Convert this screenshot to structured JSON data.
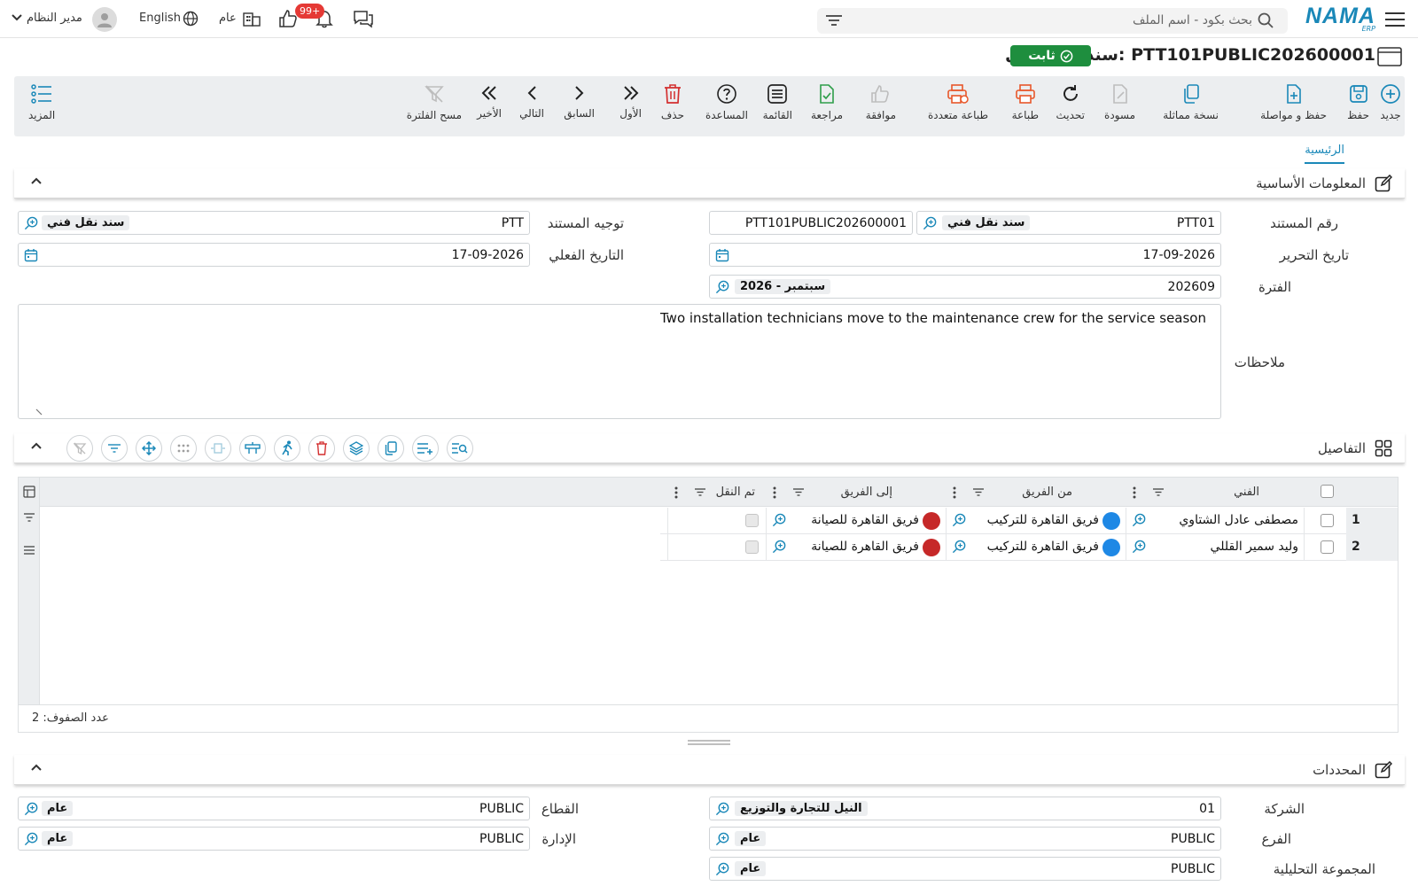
{
  "topbar": {
    "logo": "NAMA",
    "logo_sub": "ERP",
    "search_placeholder": "بحث بكود - اسم الملف",
    "user": "مدير النظام",
    "language": "English",
    "company_short": "عام",
    "notifications_badge": "99+"
  },
  "header": {
    "title": "سند نقل فني: PTT101PUBLIC202600001",
    "status": "ثابت"
  },
  "toolbar": {
    "new": "جديد",
    "save": "حفظ",
    "save_continue": "حفظ و مواصلة",
    "duplicate": "نسخة مماثلة",
    "draft": "مسودة",
    "refresh": "تحديث",
    "print": "طباعة",
    "multi_print": "طباعة متعددة",
    "approve": "موافقة",
    "review": "مراجعة",
    "list": "القائمة",
    "help": "المساعدة",
    "delete": "حذف",
    "first": "الأول",
    "previous": "السابق",
    "next": "التالي",
    "last": "الأخير",
    "clear_filter": "مسح الفلترة",
    "more": "المزيد"
  },
  "tabs": {
    "main": "الرئيسية"
  },
  "basic_info": {
    "section_title": "المعلومات الأساسية",
    "doc_number_label": "رقم المستند",
    "doc_code": "PTT01",
    "doc_type": "سند نقل فني",
    "doc_number": "PTT101PUBLIC202600001",
    "direction_label": "توجيه المستند",
    "direction_code": "PTT",
    "direction_name": "سند نقل فني",
    "edit_date_label": "تاريخ التحرير",
    "edit_date": "17-09-2026",
    "actual_date_label": "التاريخ الفعلي",
    "actual_date": "17-09-2026",
    "period_label": "الفترة",
    "period_code": "202609",
    "period_name": "2026 - سبتمبر",
    "notes_label": "ملاحظات",
    "notes": "Two installation technicians move to the maintenance crew for the service season"
  },
  "details": {
    "section_title": "التفاصيل",
    "columns": {
      "technician": "الفني",
      "from_team": "من الفريق",
      "to_team": "إلى الفريق",
      "transferred": "تم النقل"
    },
    "rows": [
      {
        "num": "1",
        "technician": "مصطفى عادل الشتاوي",
        "from_team": "فريق القاهرة للتركيب",
        "to_team": "فريق القاهرة للصيانة"
      },
      {
        "num": "2",
        "technician": "وليد سمير القللي",
        "from_team": "فريق القاهرة للتركيب",
        "to_team": "فريق القاهرة للصيانة"
      }
    ],
    "row_count": "عدد الصفوف: 2",
    "colors": {
      "from_dot": "#1e88e5",
      "to_dot": "#c62828"
    }
  },
  "dimensions": {
    "section_title": "المحددات",
    "company_label": "الشركة",
    "company_code": "01",
    "company_name": "النيل للتجارة والتوزيع",
    "sector_label": "القطاع",
    "sector_code": "PUBLIC",
    "sector_name": "عام",
    "branch_label": "الفرع",
    "branch_code": "PUBLIC",
    "branch_name": "عام",
    "department_label": "الإدارة",
    "department_code": "PUBLIC",
    "department_name": "عام",
    "analysis_group_label": "المجموعة التحليلية",
    "analysis_group_code": "PUBLIC",
    "analysis_group_name": "عام"
  },
  "accent_color": "#1a88b8"
}
